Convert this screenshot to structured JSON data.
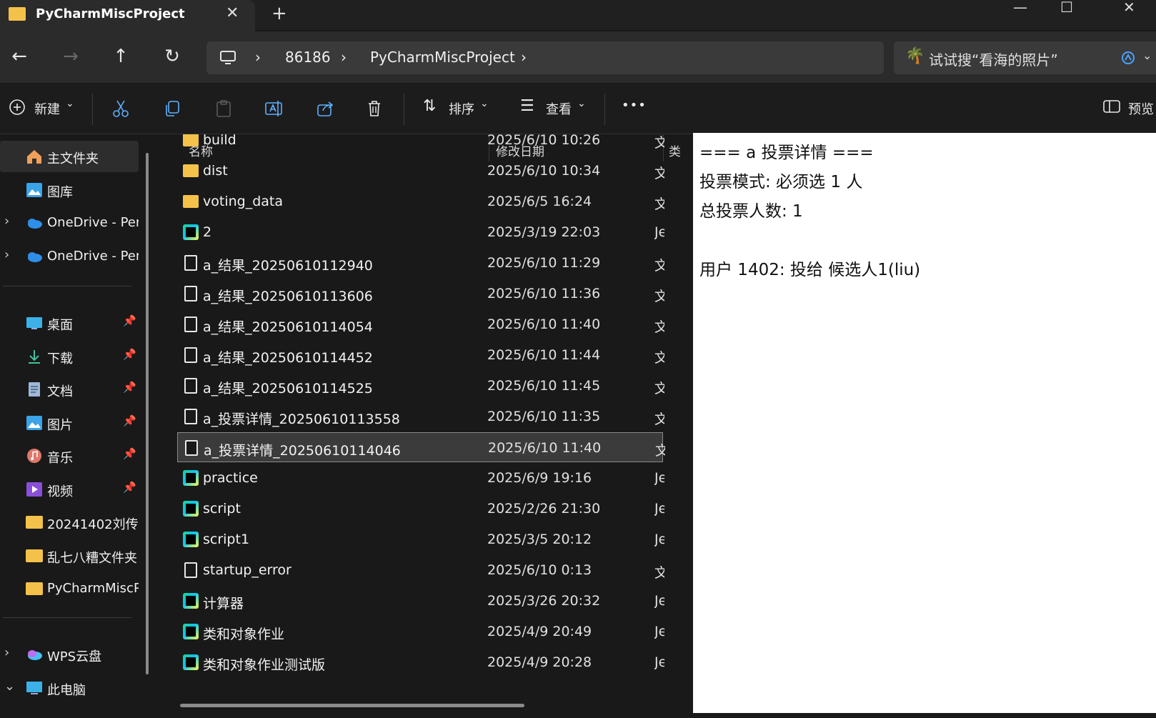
{
  "window": {
    "tab_title": "PyCharmMiscProject",
    "close_tab": "✕",
    "new_tab": "+",
    "minimize": "—",
    "maximize": "☐",
    "close": "✕"
  },
  "nav": {
    "back": "←",
    "forward": "→",
    "up": "↑",
    "refresh": "↻"
  },
  "breadcrumb": {
    "sep": "›",
    "items": [
      "86186",
      "PyCharmMiscProject"
    ]
  },
  "search": {
    "placeholder": "试试搜“看海的照片”"
  },
  "toolbar": {
    "new_label": "新建",
    "sort_label": "排序",
    "view_label": "查看",
    "more": "•••",
    "preview_label": "预览"
  },
  "sidebar": {
    "home": "主文件夹",
    "gallery": "图库",
    "onedrive1": "OneDrive - Per",
    "onedrive2": "OneDrive - Per",
    "desktop": "桌面",
    "downloads": "下载",
    "documents": "文档",
    "pictures": "图片",
    "music": "音乐",
    "videos": "视频",
    "folder1": "20241402刘传",
    "folder2": "乱七八糟文件夹",
    "folder3": "PyCharmMiscP",
    "wps": "WPS云盘",
    "thispc": "此电脑"
  },
  "columns": {
    "name": "名称",
    "date": "修改日期",
    "type": "类"
  },
  "files": [
    {
      "name": "build",
      "date": "2025/6/10 10:26",
      "type": "文",
      "icon": "folder-icon"
    },
    {
      "name": "dist",
      "date": "2025/6/10 10:34",
      "type": "文",
      "icon": "folder-icon"
    },
    {
      "name": "voting_data",
      "date": "2025/6/5 16:24",
      "type": "文",
      "icon": "folder-icon"
    },
    {
      "name": "2",
      "date": "2025/3/19 22:03",
      "type": "Je",
      "icon": "pycharm-icon"
    },
    {
      "name": "a_结果_20250610112940",
      "date": "2025/6/10 11:29",
      "type": "文",
      "icon": "text-file-icon"
    },
    {
      "name": "a_结果_20250610113606",
      "date": "2025/6/10 11:36",
      "type": "文",
      "icon": "text-file-icon"
    },
    {
      "name": "a_结果_20250610114054",
      "date": "2025/6/10 11:40",
      "type": "文",
      "icon": "text-file-icon"
    },
    {
      "name": "a_结果_20250610114452",
      "date": "2025/6/10 11:44",
      "type": "文",
      "icon": "text-file-icon"
    },
    {
      "name": "a_结果_20250610114525",
      "date": "2025/6/10 11:45",
      "type": "文",
      "icon": "text-file-icon"
    },
    {
      "name": "a_投票详情_20250610113558",
      "date": "2025/6/10 11:35",
      "type": "文",
      "icon": "text-file-icon"
    },
    {
      "name": "a_投票详情_20250610114046",
      "date": "2025/6/10 11:40",
      "type": "文",
      "icon": "text-file-icon",
      "selected": true
    },
    {
      "name": "practice",
      "date": "2025/6/9 19:16",
      "type": "Je",
      "icon": "pycharm-icon"
    },
    {
      "name": "script",
      "date": "2025/2/26 21:30",
      "type": "Je",
      "icon": "pycharm-icon"
    },
    {
      "name": "script1",
      "date": "2025/3/5 20:12",
      "type": "Je",
      "icon": "pycharm-icon"
    },
    {
      "name": "startup_error",
      "date": "2025/6/10 0:13",
      "type": "文",
      "icon": "text-file-icon"
    },
    {
      "name": "计算器",
      "date": "2025/3/26 20:32",
      "type": "Je",
      "icon": "pycharm-icon"
    },
    {
      "name": "类和对象作业",
      "date": "2025/4/9 20:49",
      "type": "Je",
      "icon": "pycharm-icon"
    },
    {
      "name": "类和对象作业测试版",
      "date": "2025/4/9 20:28",
      "type": "Je",
      "icon": "pycharm-icon"
    }
  ],
  "preview": {
    "lines": [
      "=== a 投票详情 ===",
      "投票模式: 必须选 1 人",
      "总投票人数: 1",
      "",
      "用户 1402: 投给 候选人1(liu)"
    ]
  },
  "colors": {
    "folder": "#f4c24a",
    "background": "#191919",
    "selected_row": "#3b3b3b"
  }
}
